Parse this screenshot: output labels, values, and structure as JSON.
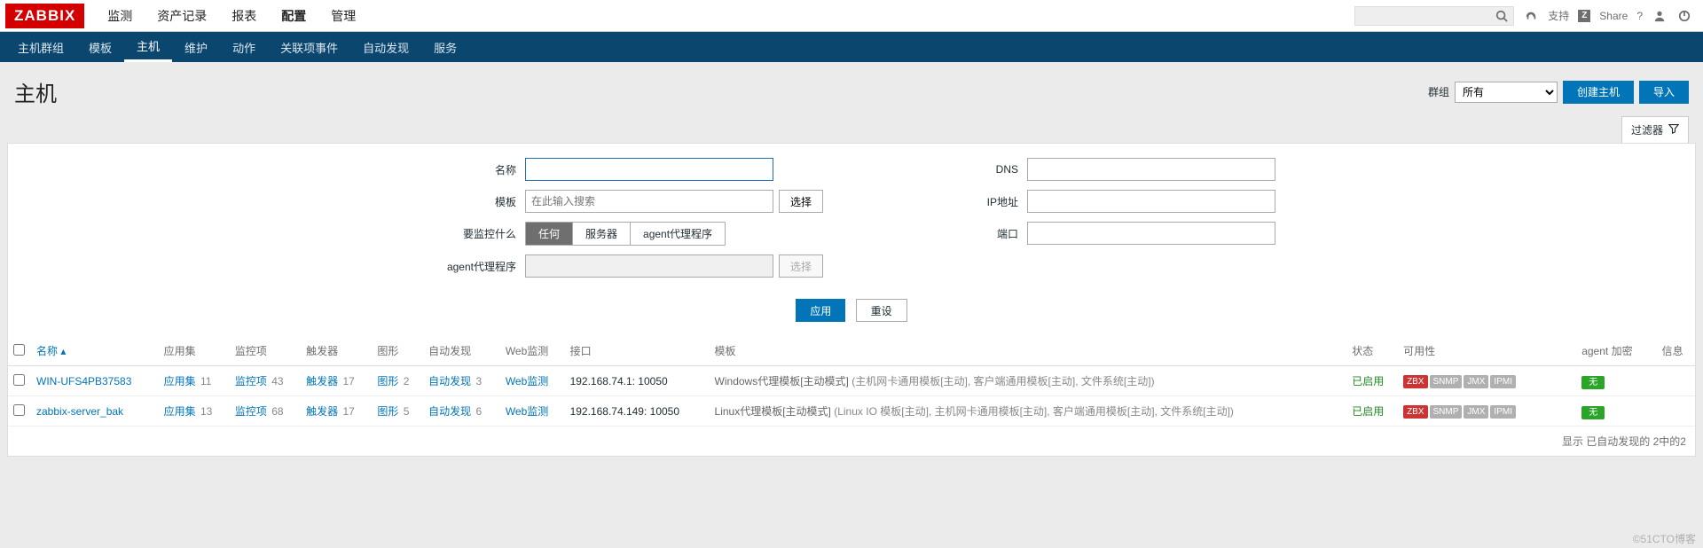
{
  "logo": "ZABBIX",
  "topnav": {
    "items": [
      {
        "label": "监测"
      },
      {
        "label": "资产记录"
      },
      {
        "label": "报表"
      },
      {
        "label": "配置",
        "active": true
      },
      {
        "label": "管理"
      }
    ]
  },
  "topright": {
    "support": "支持",
    "share": "Share",
    "help": "?"
  },
  "subnav": {
    "items": [
      {
        "label": "主机群组"
      },
      {
        "label": "模板"
      },
      {
        "label": "主机",
        "active": true
      },
      {
        "label": "维护"
      },
      {
        "label": "动作"
      },
      {
        "label": "关联项事件"
      },
      {
        "label": "自动发现"
      },
      {
        "label": "服务"
      }
    ]
  },
  "page": {
    "title": "主机",
    "group_label": "群组",
    "group_options": [
      "所有"
    ],
    "group_selected": "所有",
    "create_btn": "创建主机",
    "import_btn": "导入"
  },
  "filtertab": "过滤器",
  "filter": {
    "left": {
      "name_label": "名称",
      "name_value": "",
      "template_label": "模板",
      "template_placeholder": "在此输入搜索",
      "template_select": "选择",
      "monitor_label": "要监控什么",
      "monitor_options": [
        "任何",
        "服务器",
        "agent代理程序"
      ],
      "monitor_selected": "任何",
      "proxy_label": "agent代理程序",
      "proxy_select": "选择"
    },
    "right": {
      "dns_label": "DNS",
      "dns_value": "",
      "ip_label": "IP地址",
      "ip_value": "",
      "port_label": "端口",
      "port_value": ""
    },
    "apply": "应用",
    "reset": "重设"
  },
  "table": {
    "headers": {
      "name": "名称",
      "apps": "应用集",
      "items": "监控项",
      "triggers": "触发器",
      "graphs": "图形",
      "discovery": "自动发现",
      "web": "Web监测",
      "iface": "接口",
      "templates": "模板",
      "status": "状态",
      "availability": "可用性",
      "encryption": "agent 加密",
      "info": "信息"
    },
    "rows": [
      {
        "name": "WIN-UFS4PB37583",
        "apps": {
          "label": "应用集",
          "count": "11"
        },
        "items": {
          "label": "监控项",
          "count": "43"
        },
        "triggers": {
          "label": "触发器",
          "count": "17"
        },
        "graphs": {
          "label": "图形",
          "count": "2"
        },
        "discovery": {
          "label": "自动发现",
          "count": "3"
        },
        "web": {
          "label": "Web监测"
        },
        "iface": "192.168.74.1: 10050",
        "templates_main": "Windows代理模板[主动模式]",
        "templates_rest": " (主机网卡通用模板[主动], 客户端通用模板[主动], 文件系统[主动])",
        "status": "已启用",
        "avail": [
          {
            "t": "ZBX",
            "c": "zbx"
          },
          {
            "t": "SNMP",
            "c": "off"
          },
          {
            "t": "JMX",
            "c": "off"
          },
          {
            "t": "IPMI",
            "c": "off"
          }
        ],
        "enc": "无"
      },
      {
        "name": "zabbix-server_bak",
        "apps": {
          "label": "应用集",
          "count": "13"
        },
        "items": {
          "label": "监控项",
          "count": "68"
        },
        "triggers": {
          "label": "触发器",
          "count": "17"
        },
        "graphs": {
          "label": "图形",
          "count": "5"
        },
        "discovery": {
          "label": "自动发现",
          "count": "6"
        },
        "web": {
          "label": "Web监测"
        },
        "iface": "192.168.74.149: 10050",
        "templates_main": "Linux代理模板[主动模式]",
        "templates_rest": " (Linux IO 模板[主动], 主机网卡通用模板[主动], 客户端通用模板[主动], 文件系统[主动])",
        "status": "已启用",
        "avail": [
          {
            "t": "ZBX",
            "c": "zbx"
          },
          {
            "t": "SNMP",
            "c": "off"
          },
          {
            "t": "JMX",
            "c": "off"
          },
          {
            "t": "IPMI",
            "c": "off"
          }
        ],
        "enc": "无"
      }
    ],
    "footer": "显示 已自动发现的 2中的2"
  },
  "watermark": "©51CTO博客"
}
